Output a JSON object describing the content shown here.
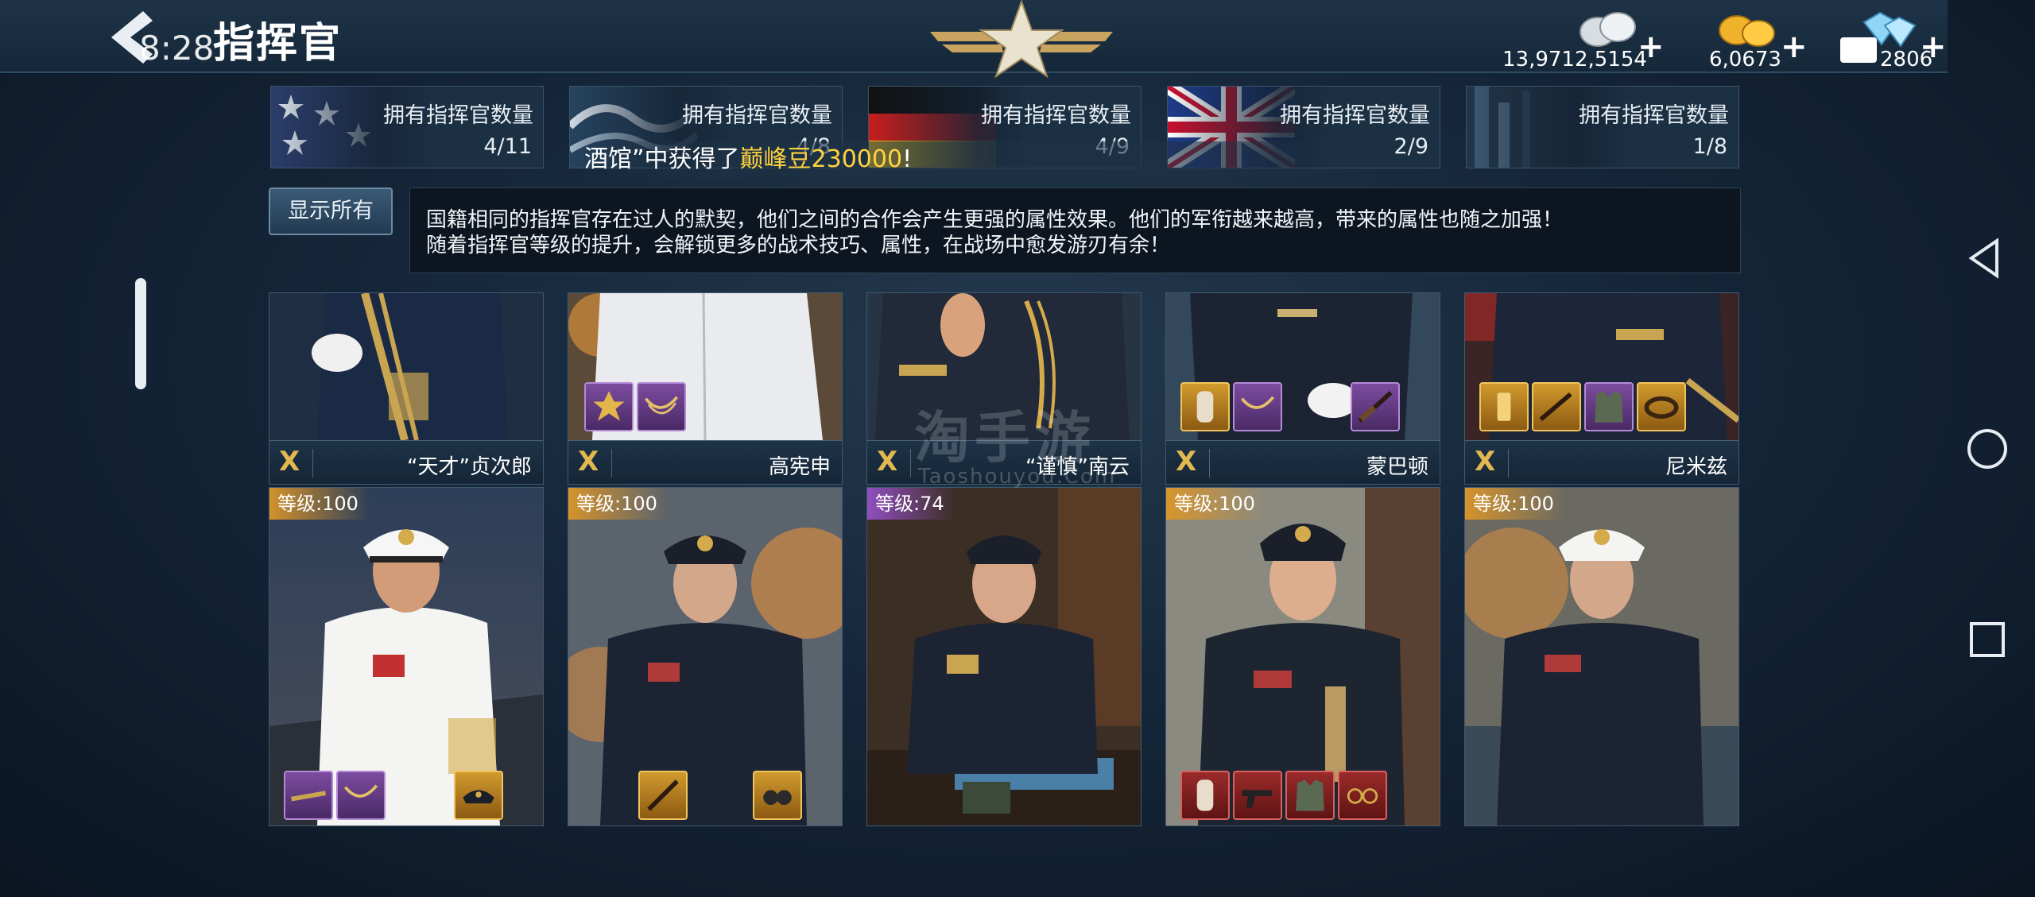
{
  "header": {
    "clock": "8:28",
    "title": "指挥官"
  },
  "resources": [
    {
      "icon": "silver-coin-icon",
      "value": "13,9712,5154",
      "plus": "+"
    },
    {
      "icon": "gold-coin-icon",
      "value": "6,0673",
      "plus": "+"
    },
    {
      "icon": "diamond-icon",
      "value": "2806",
      "plus": "+"
    }
  ],
  "nations": [
    {
      "flag": "usa-flag",
      "label": "拥有指挥官数量",
      "count": "4/11"
    },
    {
      "flag": "japan-flag",
      "label": "拥有指挥官数量",
      "count": "4/8"
    },
    {
      "flag": "germany-flag",
      "label": "拥有指挥官数量",
      "count": "4/9"
    },
    {
      "flag": "uk-flag",
      "label": "拥有指挥官数量",
      "count": "2/9"
    },
    {
      "flag": "ussr-flag",
      "label": "拥有指挥官数量",
      "count": "1/8"
    }
  ],
  "ticker": {
    "prefix": "酒馆”中获得了",
    "highlight": "巅峰豆230000",
    "suffix": "!"
  },
  "show_all_label": "显示所有",
  "description": {
    "line1": "国籍相同的指挥官存在过人的默契，他们之间的合作会产生更强的属性效果。他们的军衔越来越高，带来的属性也随之加强！",
    "line2": "随着指挥官等级的提升，会解锁更多的战术技巧、属性，在战场中愈发游刃有余！"
  },
  "top_row": [
    {
      "rank": "X",
      "name": "“天才”贞次郎",
      "equip": []
    },
    {
      "rank": "X",
      "name": "高宪申",
      "equip": [
        "purple",
        "purple"
      ]
    },
    {
      "rank": "X",
      "name": "“谨慎”南云",
      "equip": []
    },
    {
      "rank": "X",
      "name": "蒙巴顿",
      "equip": [
        "gold",
        "purple",
        "purple"
      ]
    },
    {
      "rank": "X",
      "name": "尼米兹",
      "equip": [
        "gold",
        "gold",
        "purple",
        "gold"
      ]
    }
  ],
  "bottom_row": [
    {
      "level": "等级:100",
      "tier": "gold",
      "equip": [
        "purple",
        "purple",
        "gold"
      ]
    },
    {
      "level": "等级:100",
      "tier": "gold",
      "equip": [
        "gold",
        "gold"
      ]
    },
    {
      "level": "等级:74",
      "tier": "purple",
      "equip": []
    },
    {
      "level": "等级:100",
      "tier": "gold",
      "equip": [
        "red",
        "red",
        "red",
        "red"
      ]
    },
    {
      "level": "等级:100",
      "tier": "gold",
      "equip": []
    }
  ],
  "watermark": {
    "main": "淘手游",
    "sub": "Taoshouyou.Com"
  },
  "colors": {
    "gold": "#ffd23e",
    "panel": "#15283a",
    "accent": "#e2b850"
  }
}
